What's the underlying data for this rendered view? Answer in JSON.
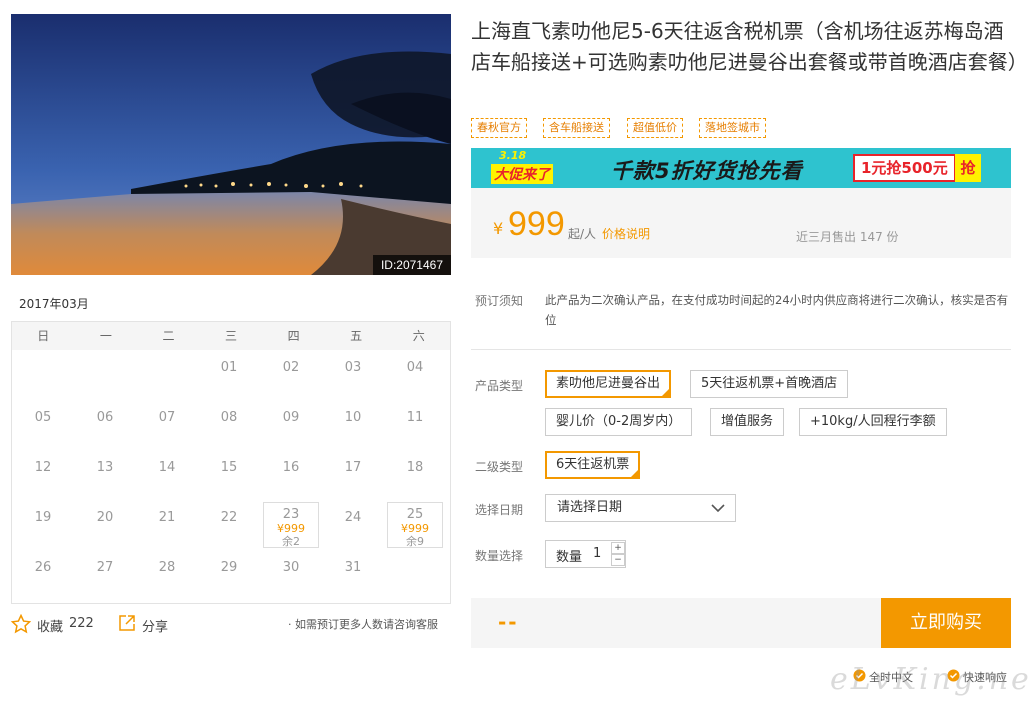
{
  "product": {
    "title": "上海直飞素叻他尼5-6天往返含税机票（含机场往返苏梅岛酒店车船接送+可选购素叻他尼进曼谷出套餐或带首晚酒店套餐）",
    "image_id": "ID:2071467",
    "tags": [
      "春秋官方",
      "含车船接送",
      "超值低价",
      "落地签城市"
    ]
  },
  "banner": {
    "badge_top": "3.18",
    "badge_bottom": "大促来了",
    "headline": "千款5折好货抢先看",
    "coupon": "1元抢500元",
    "grab": "抢"
  },
  "price": {
    "currency": "¥",
    "amount": "999",
    "unit": "起/人",
    "note": "价格说明",
    "sold": "近三月售出 147 份"
  },
  "calendar": {
    "month": "2017年03月",
    "weekdays": [
      "日",
      "一",
      "二",
      "三",
      "四",
      "五",
      "六"
    ],
    "days": [
      {
        "d": "01",
        "price": "",
        "remain": ""
      },
      {
        "d": "02",
        "price": "",
        "remain": ""
      },
      {
        "d": "03",
        "price": "",
        "remain": ""
      },
      {
        "d": "04",
        "price": "",
        "remain": ""
      },
      {
        "d": "05",
        "price": "",
        "remain": ""
      },
      {
        "d": "06",
        "price": "",
        "remain": ""
      },
      {
        "d": "07",
        "price": "",
        "remain": ""
      },
      {
        "d": "08",
        "price": "",
        "remain": ""
      },
      {
        "d": "09",
        "price": "",
        "remain": ""
      },
      {
        "d": "10",
        "price": "",
        "remain": ""
      },
      {
        "d": "11",
        "price": "",
        "remain": ""
      },
      {
        "d": "12",
        "price": "",
        "remain": ""
      },
      {
        "d": "13",
        "price": "",
        "remain": ""
      },
      {
        "d": "14",
        "price": "",
        "remain": ""
      },
      {
        "d": "15",
        "price": "",
        "remain": ""
      },
      {
        "d": "16",
        "price": "",
        "remain": ""
      },
      {
        "d": "17",
        "price": "",
        "remain": ""
      },
      {
        "d": "18",
        "price": "",
        "remain": ""
      },
      {
        "d": "19",
        "price": "",
        "remain": ""
      },
      {
        "d": "20",
        "price": "",
        "remain": ""
      },
      {
        "d": "21",
        "price": "",
        "remain": ""
      },
      {
        "d": "22",
        "price": "",
        "remain": ""
      },
      {
        "d": "23",
        "price": "¥999",
        "remain": "余2"
      },
      {
        "d": "24",
        "price": "",
        "remain": ""
      },
      {
        "d": "25",
        "price": "¥999",
        "remain": "余9"
      },
      {
        "d": "26",
        "price": "",
        "remain": ""
      },
      {
        "d": "27",
        "price": "",
        "remain": ""
      },
      {
        "d": "28",
        "price": "",
        "remain": ""
      },
      {
        "d": "29",
        "price": "",
        "remain": ""
      },
      {
        "d": "30",
        "price": "",
        "remain": ""
      },
      {
        "d": "31",
        "price": "",
        "remain": ""
      }
    ]
  },
  "actions": {
    "collect_label": "收藏",
    "collect_count": "222",
    "share_label": "分享",
    "consult_note": "· 如需预订更多人数请咨询客服"
  },
  "booking": {
    "notice_label": "预订须知",
    "notice_text": "此产品为二次确认产品，在支付成功时间起的24小时内供应商将进行二次确认，核实是否有位",
    "type_label": "产品类型",
    "types": [
      "素叻他尼进曼谷出",
      "5天往返机票+首晚酒店",
      "婴儿价（0-2周岁内）",
      "增值服务",
      "+10kg/人回程行李额"
    ],
    "subtype_label": "二级类型",
    "subtype": "6天往返机票",
    "date_label": "选择日期",
    "date_placeholder": "请选择日期",
    "qty_label": "数量选择",
    "qty_inner_label": "数量",
    "qty_value": "1",
    "qty_plus": "+",
    "qty_minus": "−"
  },
  "buy": {
    "total": "--",
    "button": "立即购买"
  },
  "services": [
    "全时中文",
    "快速响应"
  ],
  "watermark": "eLvKing.net",
  "colors": {
    "accent": "#f39800",
    "banner_bg": "#2ec3cf"
  }
}
